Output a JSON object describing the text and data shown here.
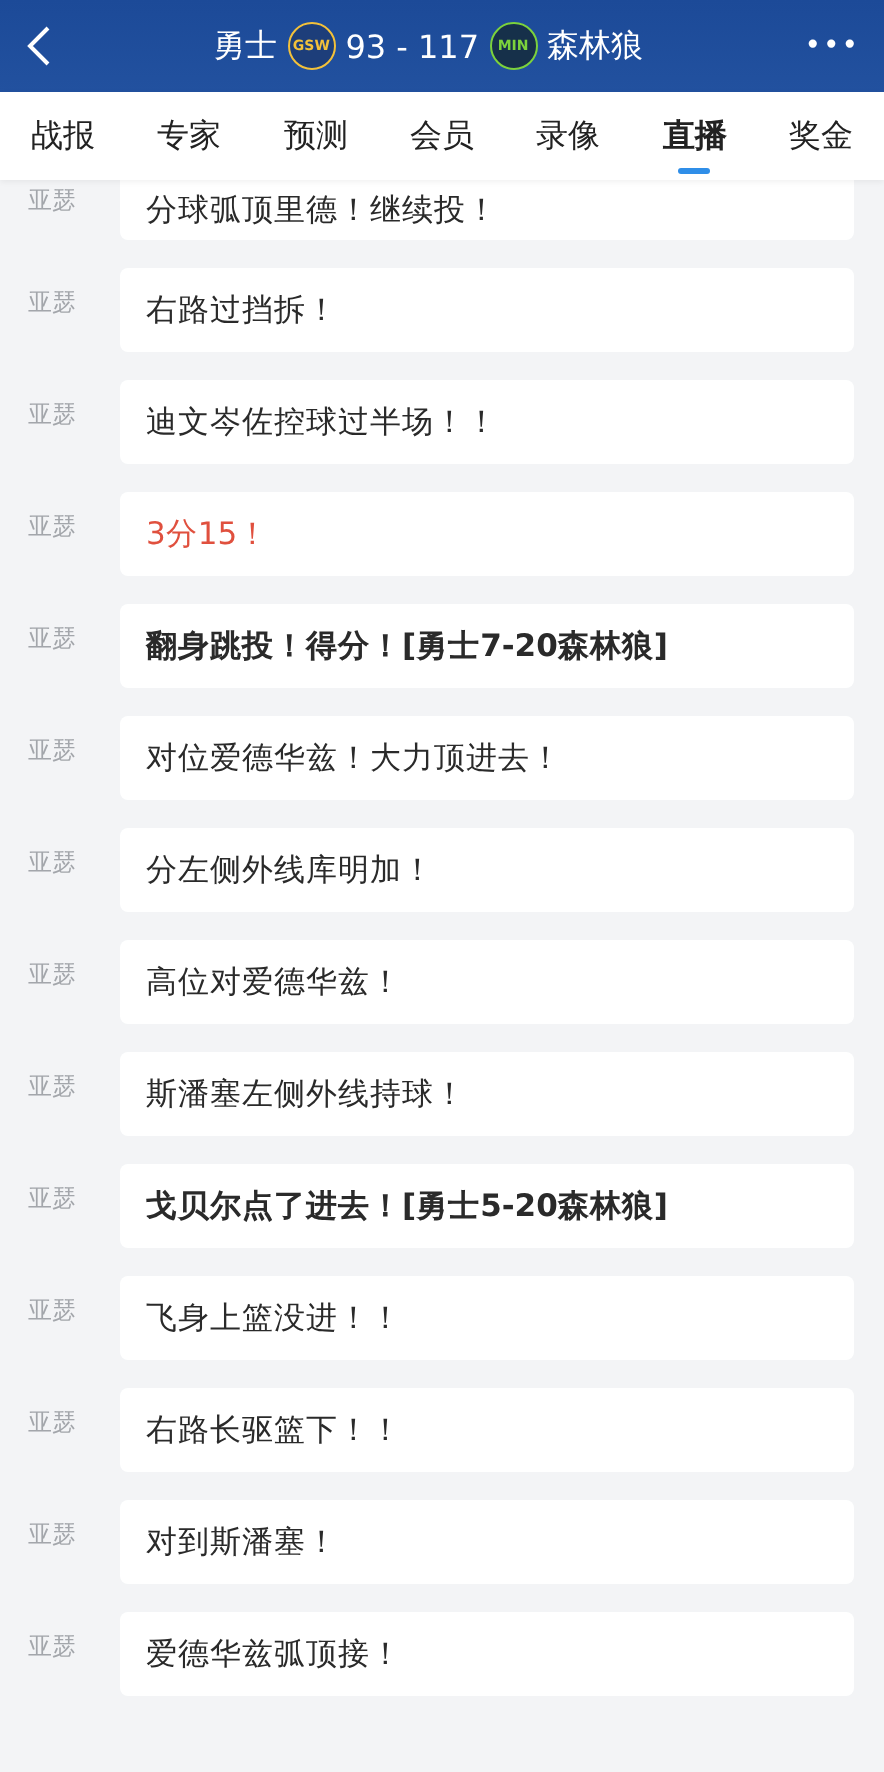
{
  "header": {
    "home_team": "勇士",
    "home_logo": "GSW",
    "score": "93 - 117",
    "away_logo": "MIN",
    "away_team": "森林狼",
    "more": "•••"
  },
  "tabs": [
    {
      "label": "战报",
      "selected": false
    },
    {
      "label": "专家",
      "selected": false
    },
    {
      "label": "预测",
      "selected": false
    },
    {
      "label": "会员",
      "selected": false
    },
    {
      "label": "录像",
      "selected": false
    },
    {
      "label": "直播",
      "selected": true
    },
    {
      "label": "奖金",
      "selected": false
    }
  ],
  "feed": [
    {
      "author": "亚瑟",
      "text": "分球弧顶里德！继续投！",
      "kind": "normal"
    },
    {
      "author": "亚瑟",
      "text": "右路过挡拆！",
      "kind": "normal"
    },
    {
      "author": "亚瑟",
      "text": "迪文岑佐控球过半场！！",
      "kind": "normal"
    },
    {
      "author": "亚瑟",
      "text": "3分15！",
      "kind": "time"
    },
    {
      "author": "亚瑟",
      "text": "翻身跳投！得分！[勇士7-20森林狼]",
      "kind": "score"
    },
    {
      "author": "亚瑟",
      "text": "对位爱德华兹！大力顶进去！",
      "kind": "normal"
    },
    {
      "author": "亚瑟",
      "text": "分左侧外线库明加！",
      "kind": "normal"
    },
    {
      "author": "亚瑟",
      "text": "高位对爱德华兹！",
      "kind": "normal"
    },
    {
      "author": "亚瑟",
      "text": "斯潘塞左侧外线持球！",
      "kind": "normal"
    },
    {
      "author": "亚瑟",
      "text": "戈贝尔点了进去！[勇士5-20森林狼]",
      "kind": "score"
    },
    {
      "author": "亚瑟",
      "text": "飞身上篮没进！！",
      "kind": "normal"
    },
    {
      "author": "亚瑟",
      "text": "右路长驱篮下！！",
      "kind": "normal"
    },
    {
      "author": "亚瑟",
      "text": "对到斯潘塞！",
      "kind": "normal"
    },
    {
      "author": "亚瑟",
      "text": "爱德华兹弧顶接！",
      "kind": "normal"
    }
  ]
}
